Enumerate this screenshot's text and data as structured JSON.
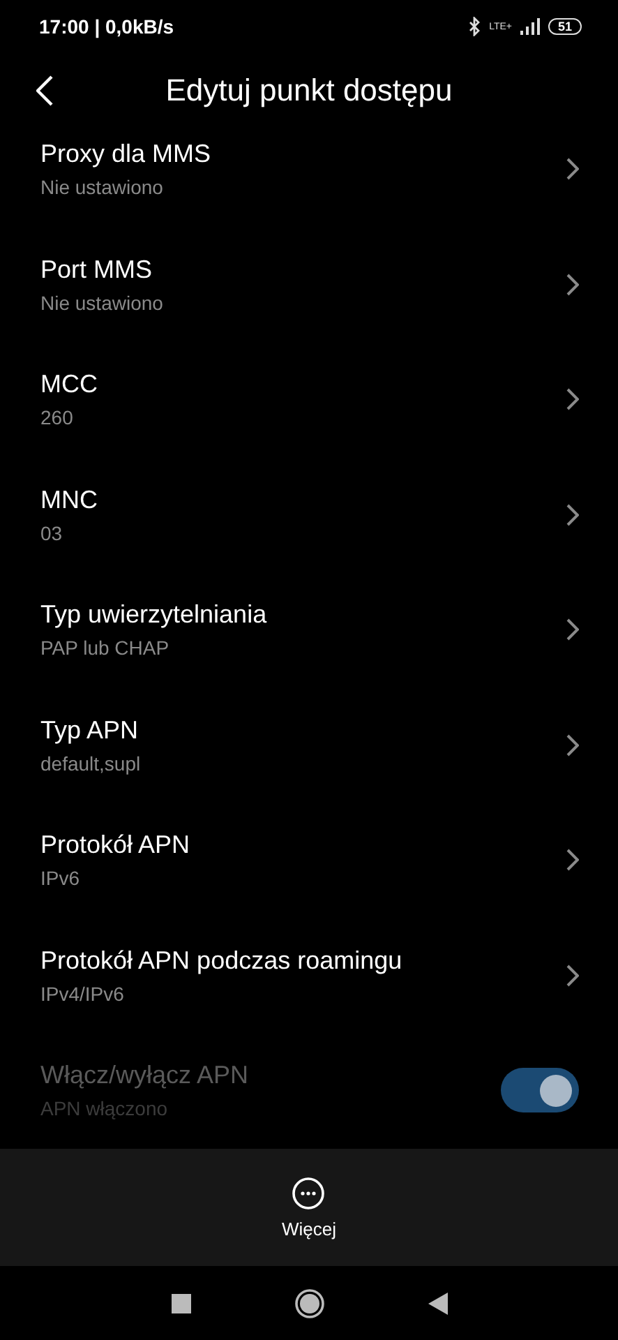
{
  "status_bar": {
    "time": "17:00 | 0,0kB/s",
    "network": "LTE+",
    "battery": "51"
  },
  "header": {
    "title": "Edytuj punkt dostępu"
  },
  "items": [
    {
      "kind": "link",
      "title": "Proxy dla MMS",
      "value": "Nie ustawiono"
    },
    {
      "kind": "link",
      "title": "Port MMS",
      "value": "Nie ustawiono"
    },
    {
      "kind": "link",
      "title": "MCC",
      "value": "260"
    },
    {
      "kind": "link",
      "title": "MNC",
      "value": "03"
    },
    {
      "kind": "link",
      "title": "Typ uwierzytelniania",
      "value": "PAP lub CHAP"
    },
    {
      "kind": "link",
      "title": "Typ APN",
      "value": "default,supl"
    },
    {
      "kind": "link",
      "title": "Protokół APN",
      "value": "IPv6"
    },
    {
      "kind": "link",
      "title": "Protokół APN podczas roamingu",
      "value": "IPv4/IPv6"
    },
    {
      "kind": "toggle",
      "title": "Włącz/wyłącz APN",
      "value": "APN włączono",
      "on": true,
      "disabled": true
    }
  ],
  "bottom_bar": {
    "more_label": "Więcej"
  }
}
